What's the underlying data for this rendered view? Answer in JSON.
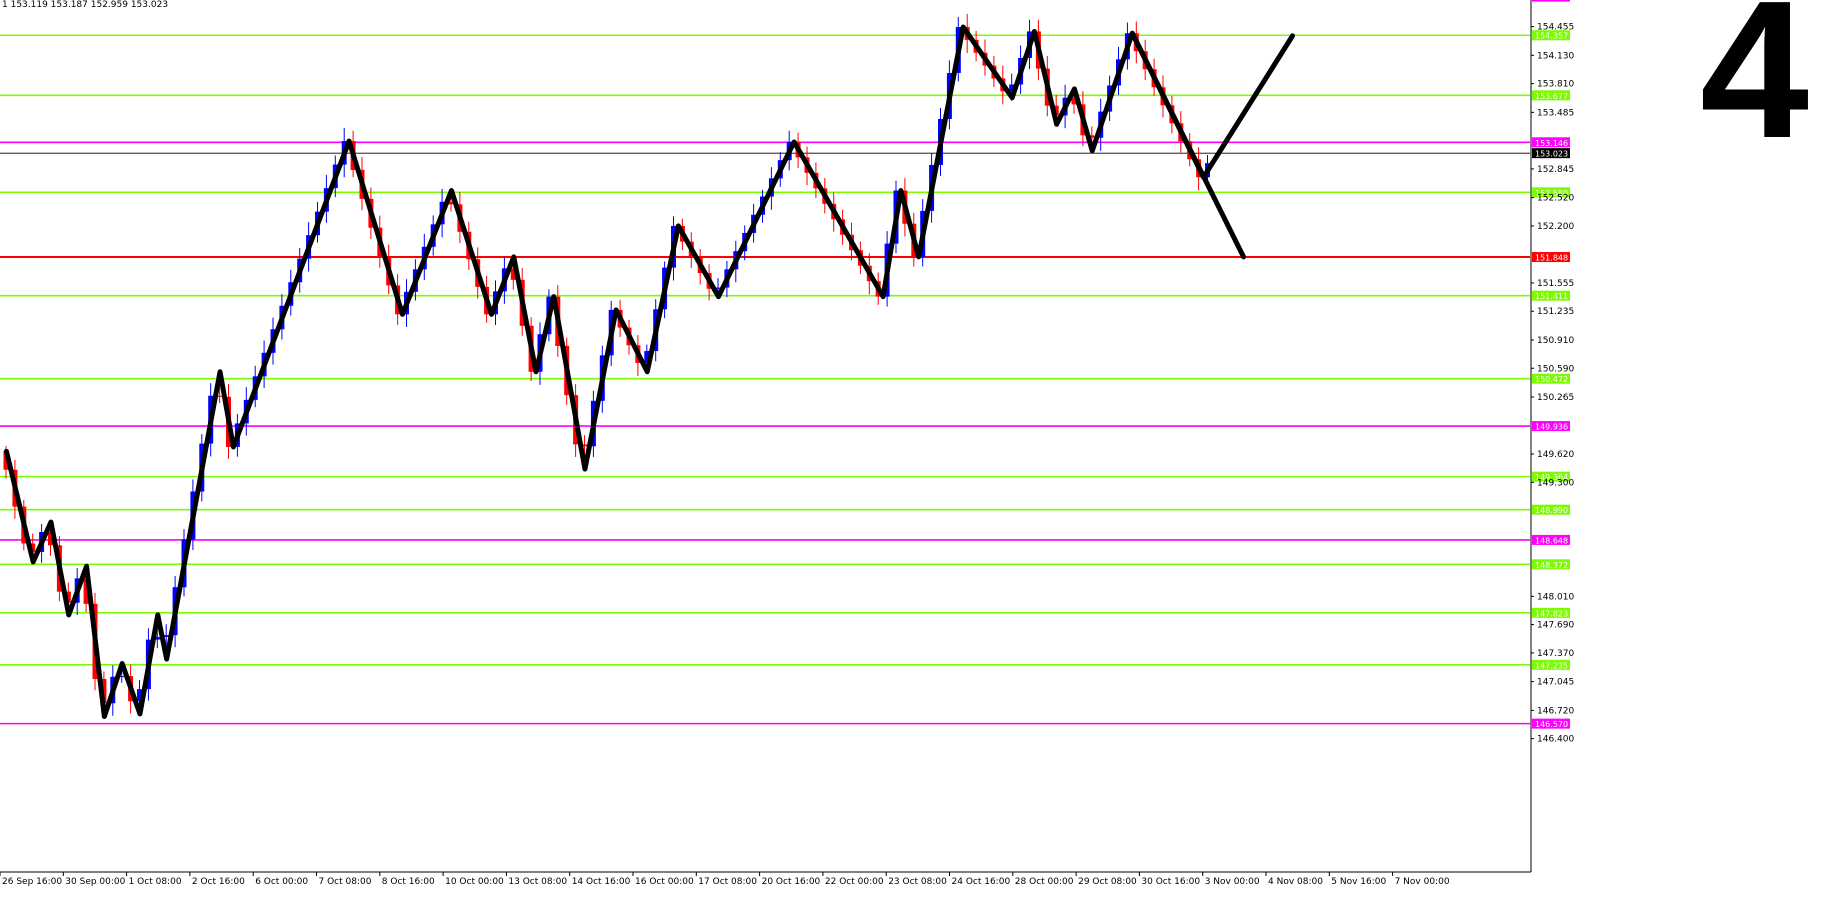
{
  "header": {
    "ohlc_text": "1 153.119 153.187 152.959 153.023",
    "wave_label": "4"
  },
  "chart_data": {
    "type": "candlestick",
    "title": "",
    "xlabel": "",
    "ylabel": "",
    "ylim": [
      146.3,
      154.83
    ],
    "x_tick_labels": [
      "26 Sep 16:00",
      "30 Sep 00:00",
      "1 Oct 08:00",
      "2 Oct 16:00",
      "6 Oct 00:00",
      "7 Oct 08:00",
      "8 Oct 16:00",
      "10 Oct 00:00",
      "13 Oct 08:00",
      "14 Oct 16:00",
      "16 Oct 00:00",
      "17 Oct 08:00",
      "20 Oct 16:00",
      "22 Oct 00:00",
      "23 Oct 08:00",
      "24 Oct 16:00",
      "28 Oct 00:00",
      "29 Oct 08:00",
      "30 Oct 16:00",
      "3 Nov 00:00",
      "4 Nov 08:00",
      "5 Nov 16:00",
      "7 Nov 00:00"
    ],
    "y_tick_labels": [
      "154.455",
      "154.130",
      "153.810",
      "153.485",
      "152.845",
      "152.520",
      "152.200",
      "151.555",
      "151.235",
      "150.910",
      "150.590",
      "150.265",
      "149.620",
      "149.300",
      "148.010",
      "147.690",
      "147.370",
      "147.045",
      "146.720",
      "146.400"
    ],
    "current_price": "153.023",
    "horizontal_levels": [
      {
        "value": 154.794,
        "label": "154.794",
        "color": "#ff00ff"
      },
      {
        "value": 154.357,
        "label": "154.357",
        "color": "#7cfc00"
      },
      {
        "value": 153.677,
        "label": "153.677",
        "color": "#7cfc00"
      },
      {
        "value": 153.146,
        "label": "153.146",
        "color": "#ff00ff"
      },
      {
        "value": 152.58,
        "label": "152.580",
        "color": "#7cfc00"
      },
      {
        "value": 151.848,
        "label": "151.848",
        "color": "#ff0000"
      },
      {
        "value": 151.411,
        "label": "151.411",
        "color": "#7cfc00"
      },
      {
        "value": 150.472,
        "label": "150.472",
        "color": "#7cfc00"
      },
      {
        "value": 149.936,
        "label": "149.936",
        "color": "#ff00ff"
      },
      {
        "value": 149.364,
        "label": "149.364",
        "color": "#7cfc00"
      },
      {
        "value": 148.99,
        "label": "148.990",
        "color": "#7cfc00"
      },
      {
        "value": 148.648,
        "label": "148.648",
        "color": "#ff00ff"
      },
      {
        "value": 148.372,
        "label": "148.372",
        "color": "#7cfc00"
      },
      {
        "value": 147.823,
        "label": "147.823",
        "color": "#7cfc00"
      },
      {
        "value": 147.235,
        "label": "147.235",
        "color": "#7cfc00"
      },
      {
        "value": 146.57,
        "label": "146.570",
        "color": "#ff00ff"
      }
    ],
    "zigzag_points": [
      [
        0.5,
        149.65
      ],
      [
        3.5,
        148.4
      ],
      [
        5.5,
        148.85
      ],
      [
        7.5,
        147.8
      ],
      [
        9.5,
        148.35
      ],
      [
        11.5,
        146.65
      ],
      [
        13.5,
        147.25
      ],
      [
        15.5,
        146.68
      ],
      [
        17.5,
        147.8
      ],
      [
        18.5,
        147.3
      ],
      [
        24.5,
        150.55
      ],
      [
        26,
        149.7
      ],
      [
        39,
        153.16
      ],
      [
        45,
        151.2
      ],
      [
        50.5,
        152.6
      ],
      [
        55,
        151.2
      ],
      [
        57.5,
        151.85
      ],
      [
        60,
        150.55
      ],
      [
        62,
        151.4
      ],
      [
        65.5,
        149.45
      ],
      [
        69,
        151.25
      ],
      [
        72.5,
        150.55
      ],
      [
        76,
        152.2
      ],
      [
        80.5,
        151.4
      ],
      [
        89,
        153.15
      ],
      [
        99,
        151.4
      ],
      [
        101,
        152.6
      ],
      [
        103,
        151.85
      ],
      [
        108,
        154.45
      ],
      [
        113.5,
        153.65
      ],
      [
        116,
        154.4
      ],
      [
        118.5,
        153.35
      ],
      [
        120.5,
        153.75
      ],
      [
        122.5,
        153.05
      ],
      [
        127,
        154.38
      ],
      [
        135,
        152.75
      ],
      [
        145,
        154.35
      ]
    ],
    "projection_points": [
      [
        127,
        154.38
      ],
      [
        139.5,
        151.85
      ]
    ],
    "candle_count": 136,
    "colors": {
      "bull": "#0000ff",
      "bear": "#ff0000",
      "zigzag": "#000000",
      "current_price_line": "#000000"
    }
  }
}
